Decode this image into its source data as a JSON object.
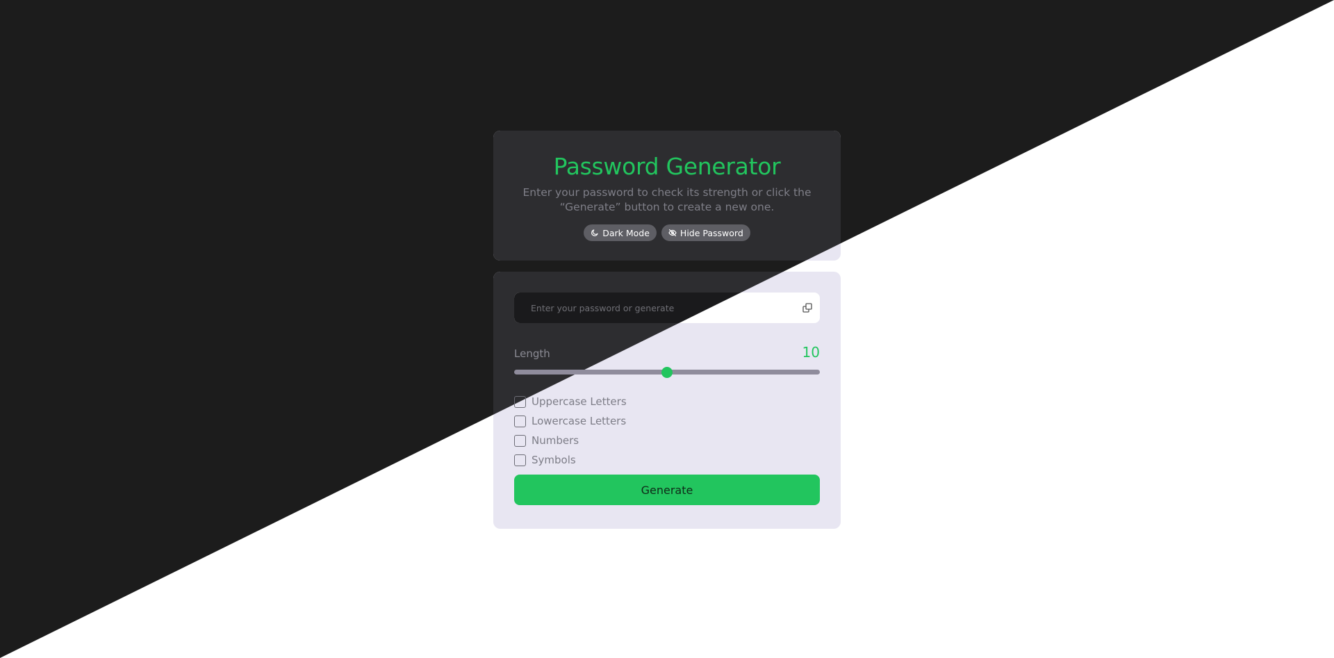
{
  "header": {
    "title": "Password Generator",
    "subtitle": "Enter your password to check its strength or click the “Generate” button to create a new one.",
    "dark_mode_label": "Dark Mode",
    "hide_password_label": "Hide Password"
  },
  "password": {
    "placeholder": "Enter your password or generate",
    "value": ""
  },
  "length": {
    "label": "Length",
    "value": "10",
    "slider_fraction": 0.5
  },
  "options": [
    {
      "label": "Uppercase Letters",
      "checked": false
    },
    {
      "label": "Lowercase Letters",
      "checked": false
    },
    {
      "label": "Numbers",
      "checked": false
    },
    {
      "label": "Symbols",
      "checked": false
    }
  ],
  "generate_label": "Generate",
  "icons": {
    "dark_mode": "moon-icon",
    "hide_password": "eye-off-icon",
    "copy": "copy-icon"
  },
  "colors": {
    "accent": "#22c55e",
    "page_dark": "#1c1c1c",
    "page_light": "#ffffff",
    "card_dark": "#2d2d30",
    "card_light": "#e8e6f2"
  }
}
